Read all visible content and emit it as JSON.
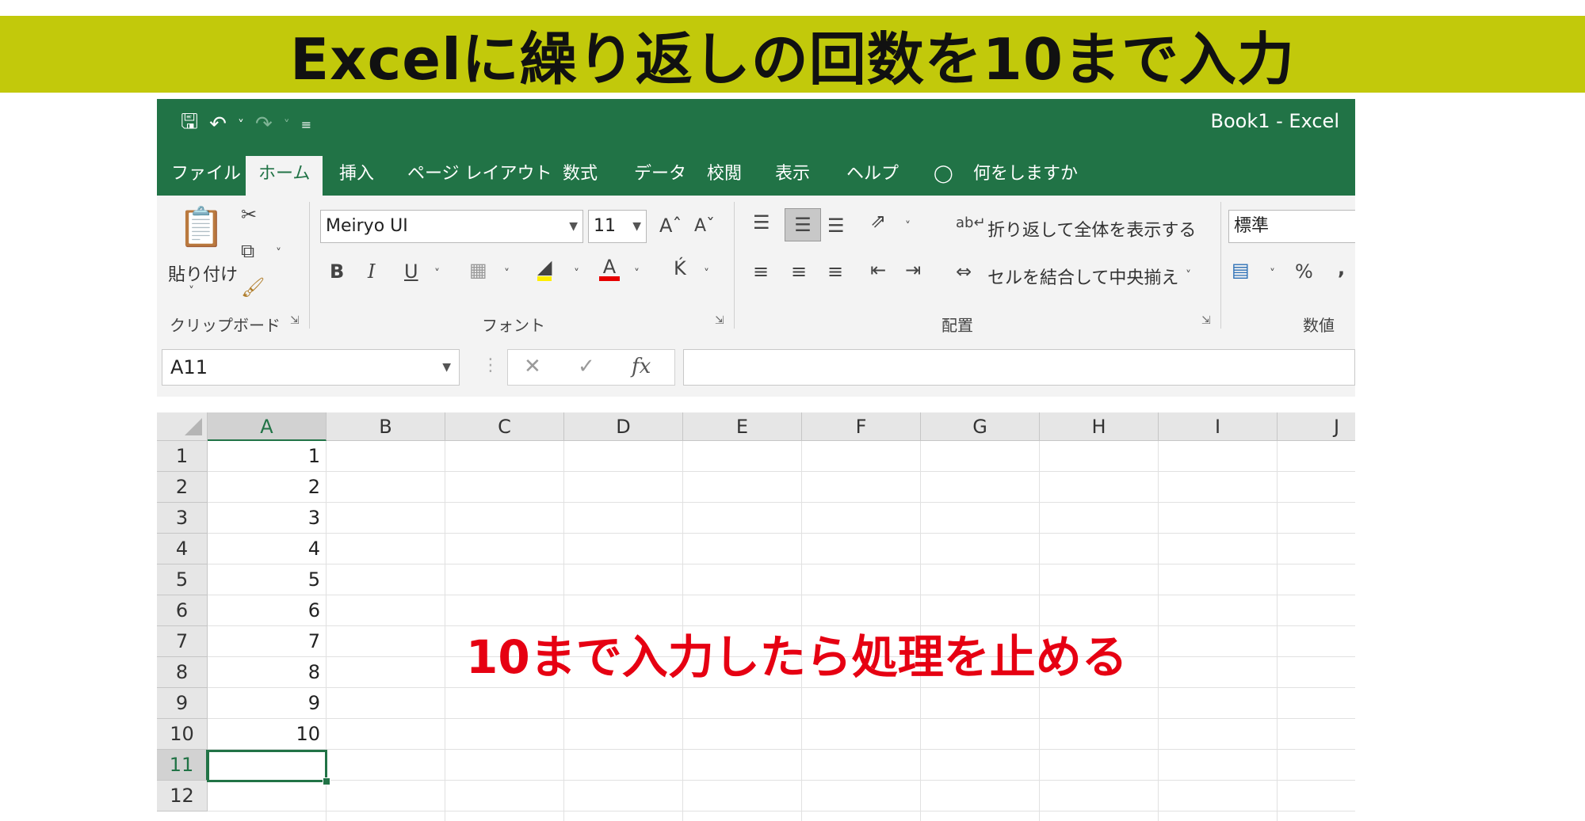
{
  "banner": {
    "title": "Excelに繰り返しの回数を10まで入力"
  },
  "window": {
    "title": "Book1 - Excel"
  },
  "tabs": [
    {
      "label": "ファイル"
    },
    {
      "label": "ホーム",
      "active": true
    },
    {
      "label": "挿入"
    },
    {
      "label": "ページ レイアウト"
    },
    {
      "label": "数式"
    },
    {
      "label": "データ"
    },
    {
      "label": "校閲"
    },
    {
      "label": "表示"
    },
    {
      "label": "ヘルプ"
    }
  ],
  "tell_me": "何をしますか",
  "ribbon": {
    "clipboard": {
      "paste_label": "貼り付け",
      "group_label": "クリップボード"
    },
    "font": {
      "name": "Meiryo UI",
      "size": "11",
      "group_label": "フォント",
      "bold": "B",
      "italic": "I",
      "underline": "U",
      "font_color_letter": "A"
    },
    "alignment": {
      "wrap_text": "折り返して全体を表示する",
      "merge_center": "セルを結合して中央揃え",
      "group_label": "配置"
    },
    "number": {
      "format": "標準",
      "percent": "%",
      "comma": ",",
      "group_label": "数値"
    }
  },
  "formula_bar": {
    "name_box": "A11",
    "fx": "fx",
    "value": ""
  },
  "sheet": {
    "columns": [
      "A",
      "B",
      "C",
      "D",
      "E",
      "F",
      "G",
      "H",
      "I",
      "J"
    ],
    "rows": [
      "1",
      "2",
      "3",
      "4",
      "5",
      "6",
      "7",
      "8",
      "9",
      "10",
      "11",
      "12"
    ],
    "column_a_values": [
      "1",
      "2",
      "3",
      "4",
      "5",
      "6",
      "7",
      "8",
      "9",
      "10"
    ],
    "active_cell": "A11"
  },
  "annotation": "10まで入力したら処理を止める",
  "colors": {
    "excel_green": "#217346",
    "banner": "#c2c90b",
    "annotation": "#e60012"
  }
}
